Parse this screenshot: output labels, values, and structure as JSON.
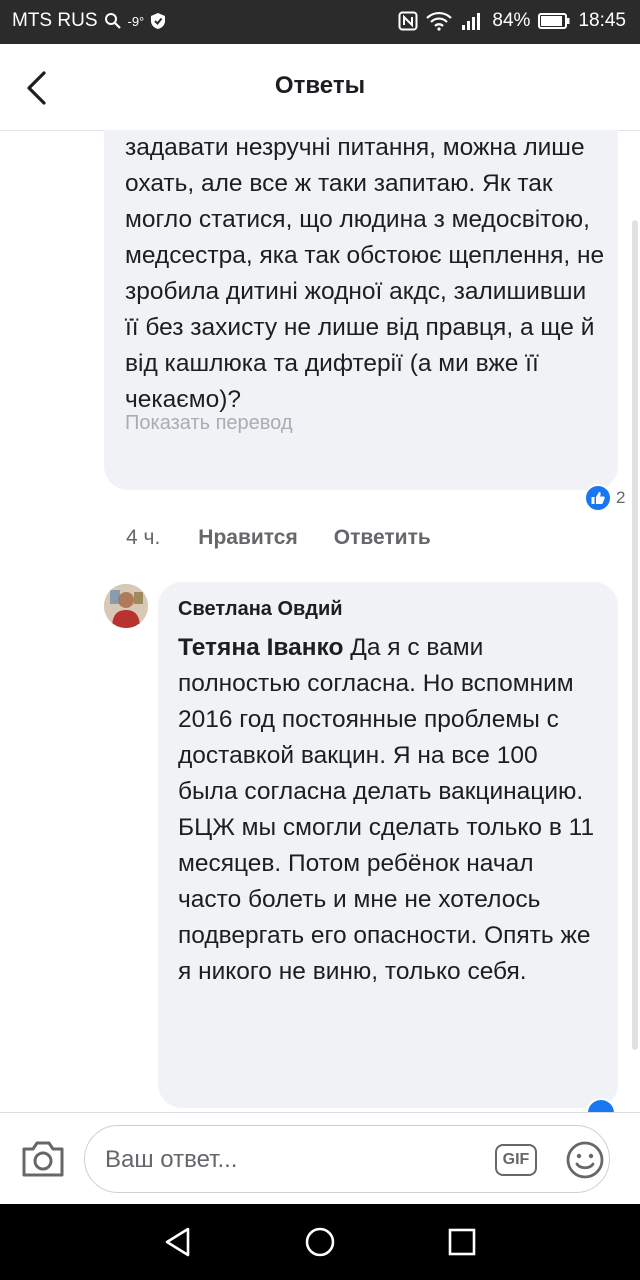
{
  "status_bar": {
    "carrier": "MTS RUS",
    "temperature": "-9°",
    "battery": "84%",
    "time": "18:45"
  },
  "header": {
    "title": "Ответы"
  },
  "comment_1": {
    "text": "задавати незручні питання, можна лише охать, але все ж таки запитаю. Як так могло статися, що людина з медосвітою, медсестра, яка так обстоює щеплення, не зробила дитині жодної акдс, залишивши її без захисту не лише від правця, а ще й від кашлюка та дифтерії (а ми вже її чекаємо)?",
    "translate_label": "Показать перевод",
    "reaction_count": "2",
    "time_ago": "4 ч.",
    "like_label": "Нравится",
    "reply_label": "Ответить"
  },
  "comment_2": {
    "author": "Светлана Овдий",
    "mention": "Тетяна Іванко",
    "text": " Да я с вами полностью согласна. Но вспомним 2016 год постоянные проблемы с доставкой вакцин. Я на все 100 была согласна делать вакцинацию. БЦЖ мы смогли сделать только  в 11 месяцев. Потом ребёнок начал часто болеть и мне не хотелось подвергать его опасности. Опять же я никого не виню, только себя."
  },
  "composer": {
    "placeholder": "Ваш ответ...",
    "gif_label": "GIF"
  },
  "colors": {
    "bubble": "#f0f2f5",
    "meta": "#65676b",
    "like_blue": "#1877f2",
    "status_bar": "#2b2b2b"
  }
}
